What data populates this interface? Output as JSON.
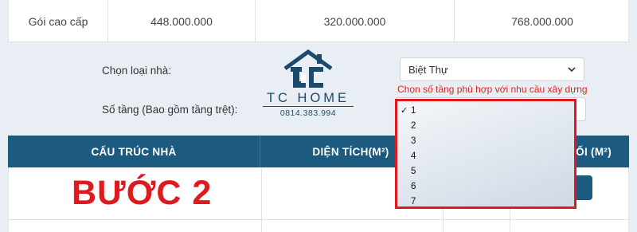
{
  "price_row": {
    "package": "Gói cao cấp",
    "rough_cost": "448.000.000",
    "finish_cost": "320.000.000",
    "total_cost": "768.000.000"
  },
  "form": {
    "house_type_label": "Chọn loại nhà:",
    "house_type_value": "Biệt Thự",
    "floors_label": "Số tầng (Bao gồm tầng trệt):",
    "floors_hint": "Chọn số tầng phù hợp với nhu cầu xây dựng",
    "floor_options": [
      "1",
      "2",
      "3",
      "4",
      "5",
      "6",
      "7"
    ],
    "floor_selected": "1"
  },
  "logo": {
    "brand": "TC HOME",
    "phone": "0814.383.994",
    "color": "#1b4a6c"
  },
  "table": {
    "headers": [
      "CẤU TRÚC NHÀ",
      "DIỆN TÍCH(M²)",
      "ỐI (M²)"
    ]
  },
  "overlay": {
    "step_text": "BƯỚC 2"
  },
  "colors": {
    "header_bg": "#1d5a80",
    "highlight": "#e0191e"
  }
}
